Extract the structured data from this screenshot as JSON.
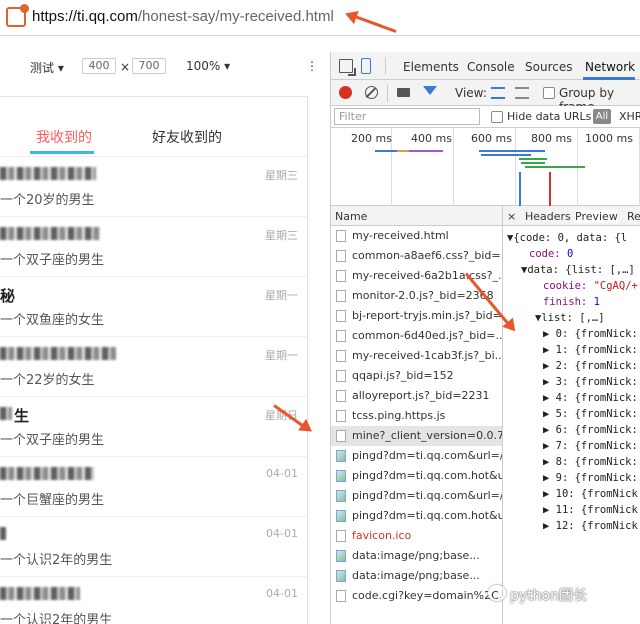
{
  "browser": {
    "url_host": "https://ti.qq.com",
    "url_path": "/honest-say/my-received.html"
  },
  "device_toolbar": {
    "device": "测试 ▾",
    "width": "400",
    "times": "×",
    "height": "700",
    "zoom": "100% ▾",
    "more": "⋮"
  },
  "page": {
    "tabs": [
      "我收到的",
      "好友收到的"
    ],
    "messages": [
      {
        "nick": "",
        "desc": "一个20岁的男生",
        "day": "星期三"
      },
      {
        "nick": "",
        "desc": "一个双子座的男生",
        "day": "星期三"
      },
      {
        "nick": "秘",
        "desc": "一个双鱼座的女生",
        "day": "星期一"
      },
      {
        "nick": "",
        "desc": "一个22岁的女生",
        "day": "星期一"
      },
      {
        "nick": "生",
        "desc": "一个双子座的男生",
        "day": "星期日"
      },
      {
        "nick": "",
        "desc": "一个巨蟹座的男生",
        "day": "04-01"
      },
      {
        "nick": "",
        "desc": "一个认识2年的男生",
        "day": "04-01"
      },
      {
        "nick": "",
        "desc": "一个认识2年的男生",
        "day": "04-01"
      }
    ]
  },
  "devtools": {
    "tabs": [
      "Elements",
      "Console",
      "Sources",
      "Network"
    ],
    "active_tab": "Network",
    "toolbar": {
      "view_label": "View:",
      "group_label": "Group by frame"
    },
    "filter": {
      "placeholder": "Filter",
      "hide_data_urls": "Hide data URLs",
      "all": "All",
      "xhr": "XHR"
    },
    "timeline_ticks": [
      "200 ms",
      "400 ms",
      "600 ms",
      "800 ms",
      "1000 ms"
    ],
    "name_header": "Name",
    "requests": [
      {
        "name": "my-received.html",
        "type": "doc"
      },
      {
        "name": "common-a8aef6.css?_bid=...",
        "type": "doc"
      },
      {
        "name": "my-received-6a2b1a.css?_...",
        "type": "doc"
      },
      {
        "name": "monitor-2.0.js?_bid=2368",
        "type": "doc"
      },
      {
        "name": "bj-report-tryjs.min.js?_bid=...",
        "type": "doc"
      },
      {
        "name": "common-6d40ed.js?_bid=...",
        "type": "doc"
      },
      {
        "name": "my-received-1cab3f.js?_bi...",
        "type": "doc"
      },
      {
        "name": "qqapi.js?_bid=152",
        "type": "doc"
      },
      {
        "name": "alloyreport.js?_bid=2231",
        "type": "doc"
      },
      {
        "name": "tcss.ping.https.js",
        "type": "doc"
      },
      {
        "name": "mine?_client_version=0.0.7...",
        "type": "doc",
        "selected": true
      },
      {
        "name": "pingd?dm=ti.qq.com&url=/...",
        "type": "img"
      },
      {
        "name": "pingd?dm=ti.qq.com.hot&u...",
        "type": "img"
      },
      {
        "name": "pingd?dm=ti.qq.com&url=/...",
        "type": "img"
      },
      {
        "name": "pingd?dm=ti.qq.com.hot&u...",
        "type": "img"
      },
      {
        "name": "favicon.ico",
        "type": "err"
      },
      {
        "name": "data:image/png;base...",
        "type": "img"
      },
      {
        "name": "data:image/png;base...",
        "type": "img"
      },
      {
        "name": "code.cgi?key=domain%2C...",
        "type": "doc"
      }
    ],
    "preview_tabs": [
      "×",
      "Headers",
      "Preview",
      "Re"
    ],
    "preview": {
      "line0": "▼{code: 0, data: {l",
      "code_key": "code:",
      "code_val": "0",
      "data_line": "▼data: {list: [,…]",
      "cookie_key": "cookie:",
      "cookie_val": "\"CgAQ/+",
      "finish_key": "finish:",
      "finish_val": "1",
      "list_line": "▼list: [,…]",
      "items": [
        "▶ 0: {fromNick:",
        "▶ 1: {fromNick:",
        "▶ 2: {fromNick:",
        "▶ 3: {fromNick:",
        "▶ 4: {fromNick:",
        "▶ 5: {fromNick:",
        "▶ 6: {fromNick:",
        "▶ 7: {fromNick:",
        "▶ 8: {fromNick:",
        "▶ 9: {fromNick:",
        "▶ 10: {fromNick",
        "▶ 11: {fromNick",
        "▶ 12: {fromNick"
      ]
    }
  },
  "watermark": "python团长"
}
